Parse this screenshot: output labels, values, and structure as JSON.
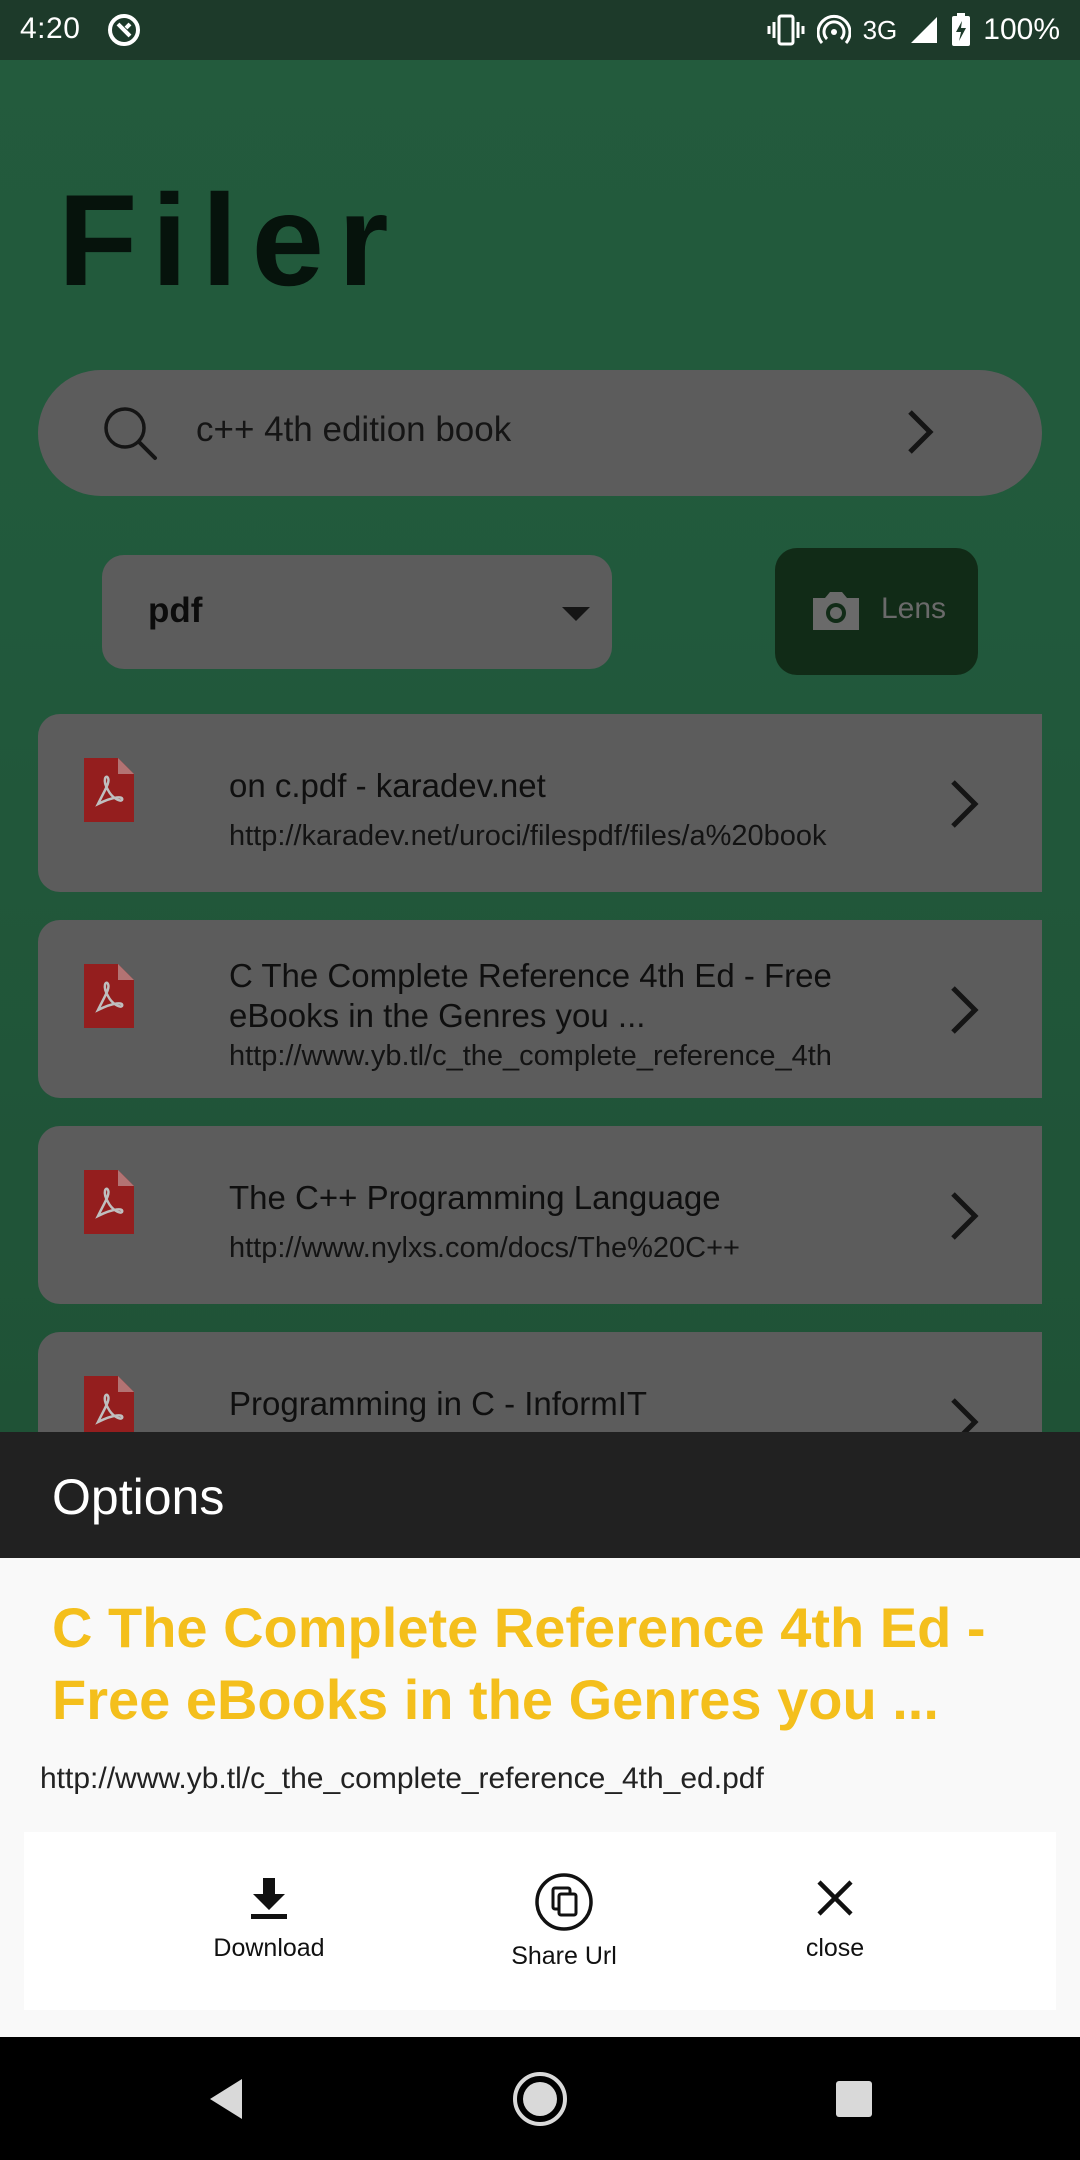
{
  "status_bar": {
    "time": "4:20",
    "network": "3G",
    "battery": "100%"
  },
  "app": {
    "title": "Filer"
  },
  "search": {
    "query": "c++ 4th edition book"
  },
  "filter": {
    "selected": "pdf"
  },
  "lens": {
    "label": "Lens"
  },
  "results": [
    {
      "title": " on c.pdf - karadev.net",
      "url": "http://karadev.net/uroci/filespdf/files/a%20book"
    },
    {
      "title": "C The Complete Reference 4th Ed - Free eBooks in the Genres you ...",
      "url": "http://www.yb.tl/c_the_complete_reference_4th"
    },
    {
      "title": "The C++ Programming Language",
      "url": "http://www.nylxs.com/docs/The%20C++"
    },
    {
      "title": "Programming in C - InformIT",
      "url": ""
    }
  ],
  "sheet": {
    "header": "Options",
    "title": "C The Complete Reference 4th Ed - Free eBooks in the Genres you ...",
    "url": "http://www.yb.tl/c_the_complete_reference_4th_ed.pdf",
    "actions": {
      "download": "Download",
      "share": "Share Url",
      "close": "close"
    }
  },
  "colors": {
    "accent_yellow": "#f4bf1c",
    "app_green": "#2f7a52",
    "pdf_red": "#c62828"
  }
}
